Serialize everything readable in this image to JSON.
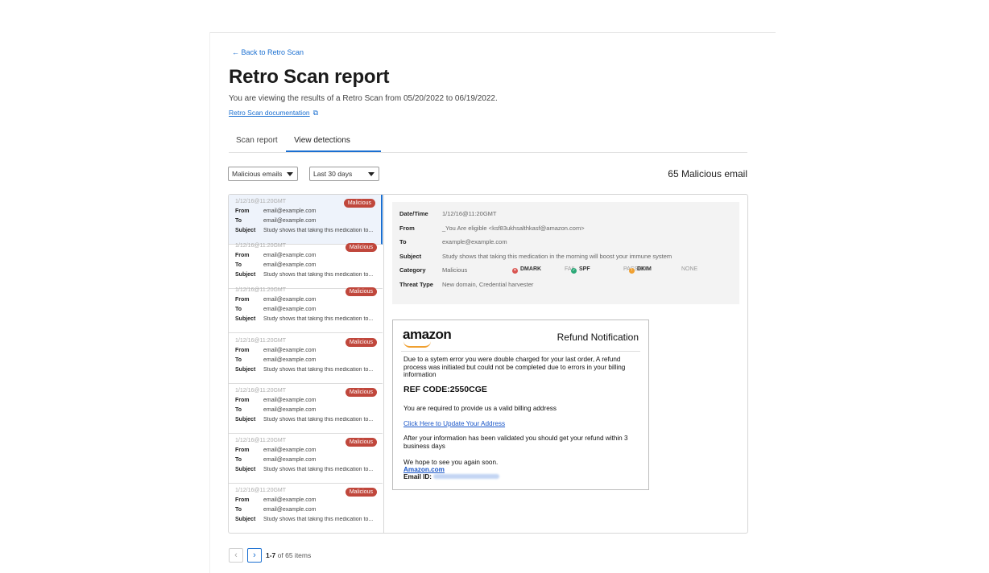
{
  "nav": {
    "back_label": "← Back to Retro Scan"
  },
  "header": {
    "title": "Retro Scan report",
    "subtitle": "You are viewing the results of a Retro Scan from 05/20/2022 to 06/19/2022.",
    "doc_link": "Retro Scan documentation"
  },
  "tabs": [
    {
      "label": "Scan report",
      "active": false
    },
    {
      "label": "View detections",
      "active": true
    }
  ],
  "filters": {
    "type_value": "Malicious emails",
    "range_value": "Last 30 days"
  },
  "summary": {
    "count_label": "65 Malicious email"
  },
  "labels": {
    "from": "From",
    "to": "To",
    "subject": "Subject"
  },
  "emails": [
    {
      "timestamp": "1/12/16@11:20GMT",
      "badge": "Malicious",
      "from": "email@example.com",
      "to": "email@example.com",
      "subject": "Study shows that taking this medication to..."
    },
    {
      "timestamp": "1/12/16@11:20GMT",
      "badge": "Malicious",
      "from": "email@example.com",
      "to": "email@example.com",
      "subject": "Study shows that taking this medication to..."
    },
    {
      "timestamp": "1/12/16@11:20GMT",
      "badge": "Malicious",
      "from": "email@example.com",
      "to": "email@example.com",
      "subject": "Study shows that taking this medication to..."
    },
    {
      "timestamp": "1/12/16@11:20GMT",
      "badge": "Malicious",
      "from": "email@example.com",
      "to": "email@example.com",
      "subject": "Study shows that taking this medication to..."
    },
    {
      "timestamp": "1/12/16@11:20GMT",
      "badge": "Malicious",
      "from": "email@example.com",
      "to": "email@example.com",
      "subject": "Study shows that taking this medication to..."
    },
    {
      "timestamp": "1/12/16@11:20GMT",
      "badge": "Malicious",
      "from": "email@example.com",
      "to": "email@example.com",
      "subject": "Study shows that taking this medication to..."
    },
    {
      "timestamp": "1/12/16@11:20GMT",
      "badge": "Malicious",
      "from": "email@example.com",
      "to": "email@example.com",
      "subject": "Study shows that taking this medication to..."
    }
  ],
  "details": {
    "datetime_label": "Date/Time",
    "datetime": "1/12/16@11:20GMT",
    "from_label": "From",
    "from": "_You Are eligible  <ksf83ukhsalthkasf@amazon.com>",
    "to_label": "To",
    "to": "example@example.com",
    "subject_label": "Subject",
    "subject": "Study shows that taking this medication in the morning will boost your immune system",
    "category_label": "Category",
    "category": "Malicious",
    "dmark_label": "DMARK",
    "dmark_status": "FAIL",
    "spf_label": "SPF",
    "spf_status": "PASSED",
    "dkim_label": "DKIM",
    "dkim_status": "NONE",
    "threat_label": "Threat Type",
    "threat": "New domain, Credential harvester"
  },
  "preview": {
    "logo": "amazon",
    "heading": "Refund Notification",
    "para1": "Due to a sytem error you were double charged for your last order, A refund process was initiated but could not be completed due to errors in  your billing information",
    "ref_code": "REF CODE:2550CGE",
    "para2": "You are required to provide us a valid billing address",
    "link": "Click Here to Update Your Address",
    "para3": "After your information has been validated you should get your refund within 3 business days",
    "sign1": "We hope to see you again soon.",
    "sign2": "Amazon.com",
    "email_id_label": "Email ID:"
  },
  "pagination": {
    "range": "1-7",
    "suffix": " of 65 items"
  },
  "colors": {
    "accent": "#1a6fd1",
    "malicious": "#c0473c",
    "fail": "#d9534f",
    "pass": "#2aa876",
    "none": "#f0a030"
  }
}
